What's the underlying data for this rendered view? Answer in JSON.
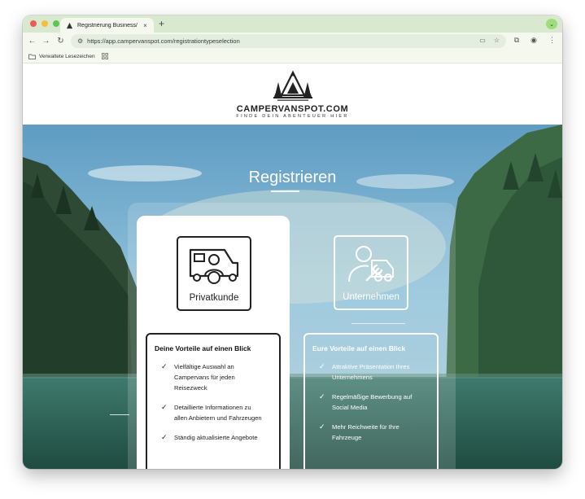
{
  "browser": {
    "tab": {
      "title": "Registrierung Business/Privat",
      "favicon": "campervan-favicon-icon",
      "close": "×"
    },
    "new_tab": "+",
    "tab_menu": "⌄",
    "address": {
      "url": "https://app.campervanspot.com/registrationtypeselection"
    },
    "bookmarks": [
      {
        "label": "Verwaltete Lesezeichen",
        "icon": "folder-icon"
      }
    ],
    "nav_icons": [
      "back-icon",
      "forward-icon",
      "reload-icon"
    ]
  },
  "site": {
    "brand": "CAMPERVANSPOT.COM",
    "tagline": "FINDE DEIN ABENTEUER HIER"
  },
  "hero": {
    "title": "Registrieren"
  },
  "options": {
    "private": {
      "label": "Privatkunde",
      "benefits_title": "Deine Vorteile auf einen Blick",
      "benefits": [
        "Vielfältige Auswahl an Campervans für jeden Reisezweck",
        "Detaillierte Informationen zu allen Anbietern und Fahrzeugen",
        "Ständig aktualisierte Angebote"
      ]
    },
    "business": {
      "label": "Unternehmen",
      "benefits_title": "Eure Vorteile auf einen Blick",
      "benefits": [
        "Attraktive Präsentation Ihres Unternehmens",
        "Regelmäßige Bewerbung auf Social Media",
        "Mehr Reichweite für Ihre Fahrzeuge"
      ]
    }
  },
  "check_glyph": "✓",
  "colors": {
    "tab_strip": "#d9e9cf",
    "toolbar": "#f4f8ef",
    "text_dark": "#222222",
    "hero_text": "#ffffff"
  }
}
